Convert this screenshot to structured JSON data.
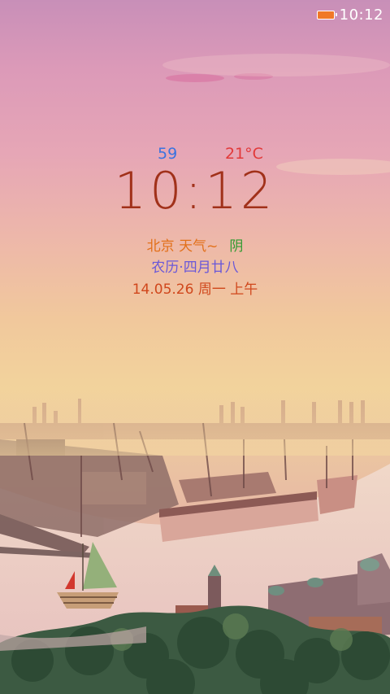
{
  "status_bar": {
    "time": "10:12",
    "battery_icon": "battery-icon",
    "battery_color": "#f07828"
  },
  "widget": {
    "top_left_value": "59",
    "temperature": "21°C",
    "clock": "10:12",
    "weather_city": "北京 天气~",
    "weather_state": "阴",
    "lunar_date": "农历·四月廿八",
    "date": "14.05.26 周一 上午"
  },
  "colors": {
    "clock": "#a1311a",
    "top_left_value": "#3a73e0",
    "temperature": "#e23a3a",
    "weather_city": "#e2701a",
    "weather_state": "#2f9b2f",
    "lunar_date": "#6a58d8",
    "date": "#d0471c"
  },
  "decorations": {
    "boat_icon": "sailboat-icon"
  }
}
